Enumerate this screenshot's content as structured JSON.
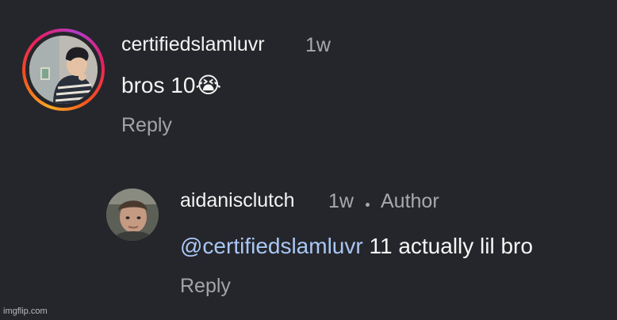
{
  "comment": {
    "username": "certifiedslamluvr",
    "time": "1w",
    "text": "bros 10",
    "emoji": "😭",
    "emoji_icon": "loudly-crying-face-emoji",
    "reply_label": "Reply"
  },
  "reply": {
    "username": "aidanisclutch",
    "time": "1w",
    "separator": "•",
    "badge": "Author",
    "mention": "@certifiedslamluvr",
    "text": " 11 actually lil bro",
    "reply_label": "Reply"
  },
  "watermark": "imgflip.com",
  "colors": {
    "background": "#25262b",
    "mention": "#a9c7f5",
    "muted": "#a8a8ad",
    "story_ring": [
      "#f9a825",
      "#f4511e",
      "#e91e63",
      "#b23cc9"
    ]
  }
}
